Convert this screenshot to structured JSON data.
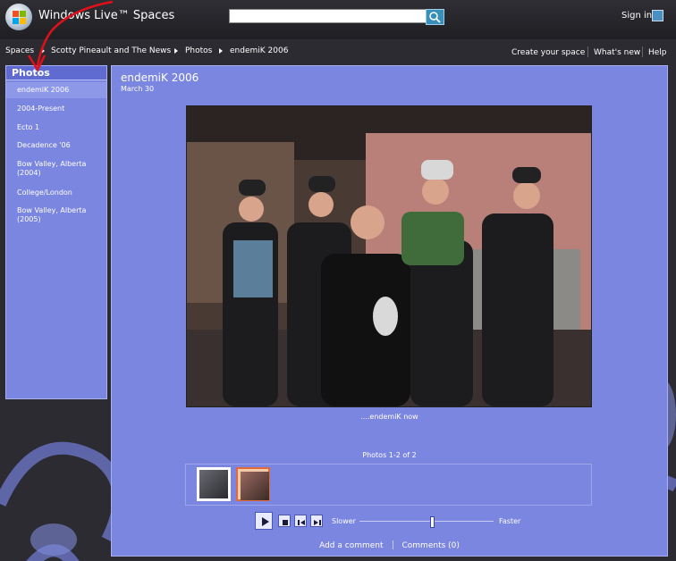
{
  "app": {
    "brand": "Windows Live™ Spaces",
    "sign_in": "Sign in"
  },
  "search": {
    "placeholder": ""
  },
  "breadcrumb": [
    "Spaces",
    "Scotty Pineault and The News",
    "Photos",
    "endemiK 2006"
  ],
  "header_links": [
    "Create your space",
    "What's new",
    "Help"
  ],
  "sidebar": {
    "heading": "Photos",
    "items": [
      {
        "label": "endemiK 2006",
        "active": true
      },
      {
        "label": "2004-Present"
      },
      {
        "label": "Ecto 1"
      },
      {
        "label": "Decadence '06"
      },
      {
        "label": "Bow Valley, Alberta (2004)"
      },
      {
        "label": "College/London"
      },
      {
        "label": "Bow Valley, Alberta (2005)"
      }
    ]
  },
  "album": {
    "title": "endemiK 2006",
    "date": "March 30"
  },
  "photo": {
    "caption": "....endemiK now"
  },
  "gallery": {
    "count_text": "Photos 1-2 of 2",
    "thumbs": 2,
    "selected": 2
  },
  "slideshow": {
    "slower": "Slower",
    "faster": "Faster",
    "speed": 0.53
  },
  "actions": {
    "add_comment": "Add a comment",
    "comments": "Comments (0)"
  },
  "colors": {
    "accent": "#7b86e0",
    "header": "#2b2b31",
    "annotation": "#e0101a"
  }
}
